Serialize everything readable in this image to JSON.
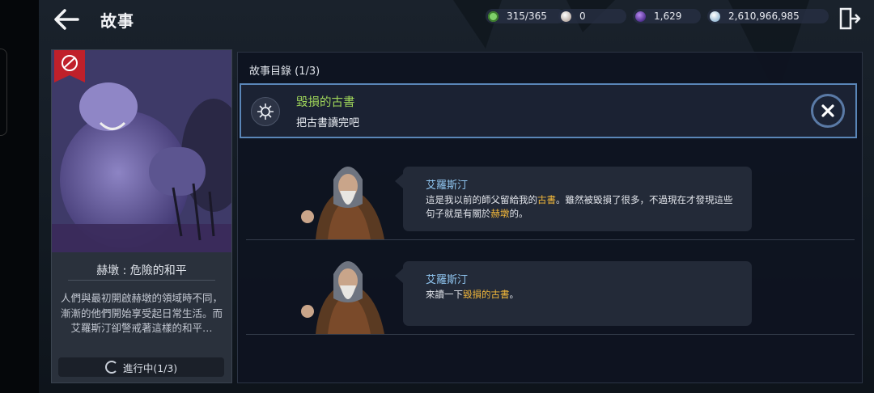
{
  "header": {
    "title": "故事",
    "resources": [
      {
        "icon": "stamina-icon",
        "color": "#7fd06a",
        "value": "315/365"
      },
      {
        "icon": "pearl-icon",
        "color": "#d9cfc9",
        "value": "0"
      },
      {
        "icon": "dark-orb-icon",
        "color": "#8a5ad6",
        "value": "1,629"
      },
      {
        "icon": "silver-coin-icon",
        "color": "#cfe3f2",
        "value": "2,610,966,985"
      }
    ]
  },
  "card": {
    "name": "赫墩 : 危險的和平",
    "description": "人們與最初開啟赫墩的領域時不同，漸漸的他們開始享受起日常生活。而艾羅斯汀卻警戒著這樣的和平…",
    "progress_label": "進行中(1/3)"
  },
  "panel": {
    "header": "故事目錄 (1/3)",
    "quest": {
      "title": "毀損的古書",
      "subtitle": "把古書讀完吧"
    },
    "dialogs": [
      {
        "speaker": "艾羅斯汀",
        "parts": [
          {
            "text": "這是我以前的師父留給我的",
            "highlight": false
          },
          {
            "text": "古書",
            "highlight": true
          },
          {
            "text": "。雖然被毀損了很多，不過現在才發現這些句子就是有關於",
            "highlight": false
          },
          {
            "text": "赫墩",
            "highlight": true
          },
          {
            "text": "的。",
            "highlight": false
          }
        ]
      },
      {
        "speaker": "艾羅斯汀",
        "parts": [
          {
            "text": "來讀一下",
            "highlight": false
          },
          {
            "text": "毀損的古書",
            "highlight": true
          },
          {
            "text": "。",
            "highlight": false
          }
        ]
      }
    ]
  },
  "colors": {
    "accent_green": "#9fd65a",
    "highlight_orange": "#f0b63a",
    "speaker_blue": "#8fc4ee",
    "flag_red": "#c0202a"
  }
}
